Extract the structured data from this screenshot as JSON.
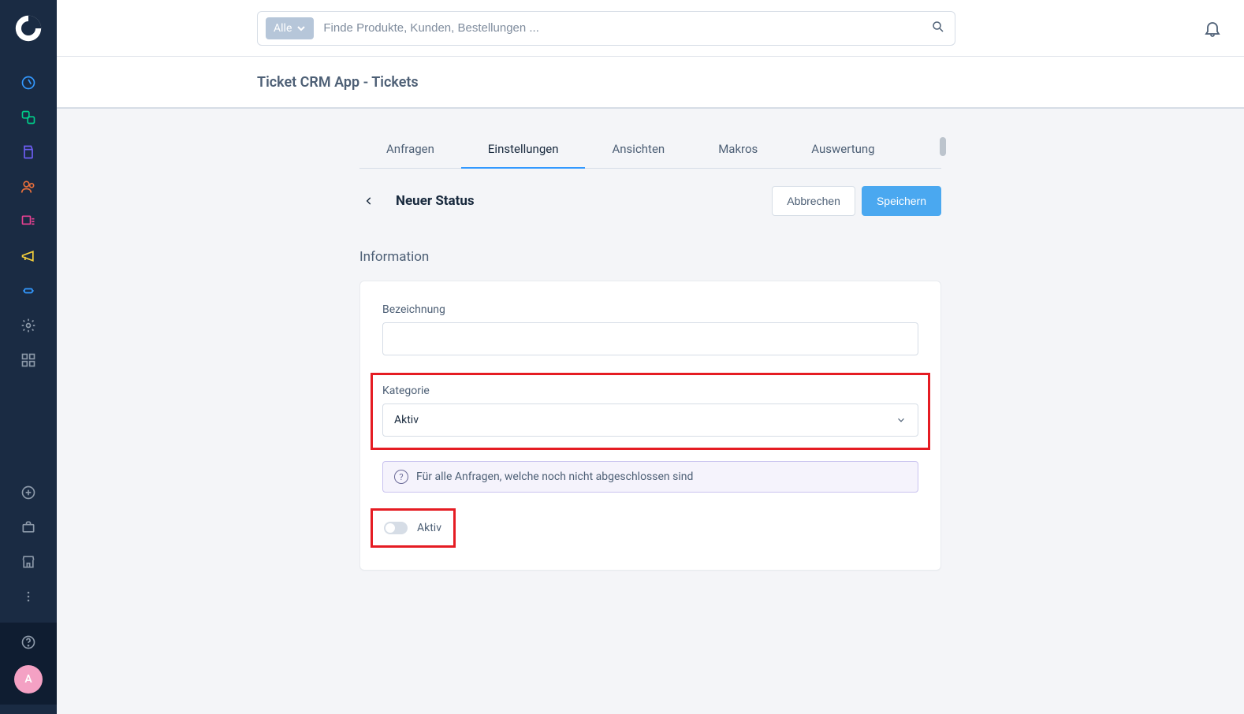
{
  "search": {
    "filter_label": "Alle",
    "placeholder": "Finde Produkte, Kunden, Bestellungen ..."
  },
  "page_title": "Ticket CRM App - Tickets",
  "tabs": [
    {
      "label": "Anfragen",
      "active": false
    },
    {
      "label": "Einstellungen",
      "active": true
    },
    {
      "label": "Ansichten",
      "active": false
    },
    {
      "label": "Makros",
      "active": false
    },
    {
      "label": "Auswertung",
      "active": false
    }
  ],
  "detail": {
    "title": "Neuer Status",
    "cancel": "Abbrechen",
    "save": "Speichern"
  },
  "section": {
    "heading": "Information",
    "bezeichnung_label": "Bezeichnung",
    "bezeichnung_value": "",
    "kategorie_label": "Kategorie",
    "kategorie_value": "Aktiv",
    "info_text": "Für alle Anfragen, welche noch nicht abgeschlossen sind",
    "toggle_label": "Aktiv"
  },
  "avatar_initial": "A",
  "sidebar_icons": [
    {
      "name": "dashboard-icon",
      "color": "#3399ff"
    },
    {
      "name": "catalog-icon",
      "color": "#00cc88"
    },
    {
      "name": "orders-icon",
      "color": "#6e5ef5"
    },
    {
      "name": "customers-icon",
      "color": "#e86f3b"
    },
    {
      "name": "content-icon",
      "color": "#e64091"
    },
    {
      "name": "marketing-icon",
      "color": "#f7d13b"
    },
    {
      "name": "extensions-icon",
      "color": "#3399ff"
    },
    {
      "name": "settings-icon",
      "color": "#8c99a9"
    },
    {
      "name": "apps-icon",
      "color": "#8c99a9"
    }
  ],
  "sidebar_bottom_icons": [
    {
      "name": "add-icon"
    },
    {
      "name": "briefcase-icon"
    },
    {
      "name": "store-icon"
    },
    {
      "name": "more-icon"
    }
  ]
}
